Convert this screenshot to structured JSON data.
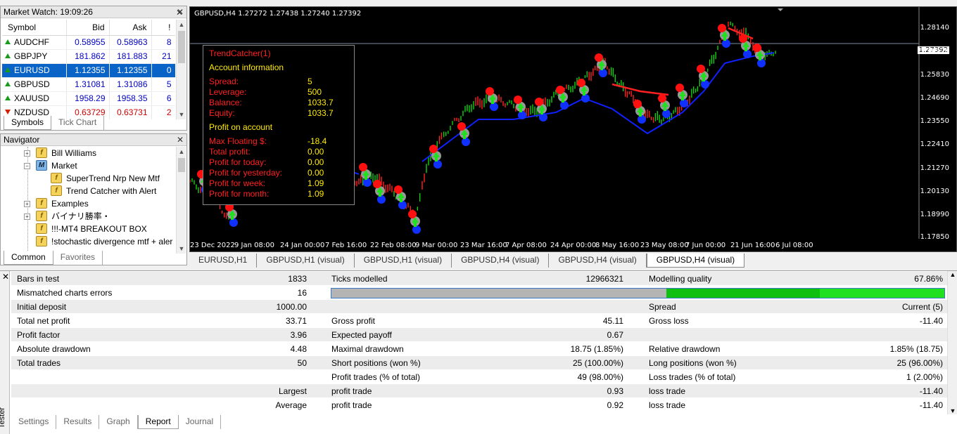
{
  "market_watch": {
    "title": "Market Watch: 19:09:26",
    "columns": {
      "symbol": "Symbol",
      "bid": "Bid",
      "ask": "Ask",
      "spread": "!"
    },
    "rows": [
      {
        "symbol": "AUDCHF",
        "bid": "0.58955",
        "ask": "0.58963",
        "spread": "8",
        "dir": "up"
      },
      {
        "symbol": "GBPJPY",
        "bid": "181.862",
        "ask": "181.883",
        "spread": "21",
        "dir": "up"
      },
      {
        "symbol": "EURUSD",
        "bid": "1.12355",
        "ask": "1.12355",
        "spread": "0",
        "dir": "up"
      },
      {
        "symbol": "GBPUSD",
        "bid": "1.31081",
        "ask": "1.31086",
        "spread": "5",
        "dir": "up"
      },
      {
        "symbol": "XAUUSD",
        "bid": "1958.29",
        "ask": "1958.35",
        "spread": "6",
        "dir": "up"
      },
      {
        "symbol": "NZDUSD",
        "bid": "0.63729",
        "ask": "0.63731",
        "spread": "2",
        "dir": "down"
      }
    ],
    "tabs": [
      "Symbols",
      "Tick Chart"
    ]
  },
  "navigator": {
    "title": "Navigator",
    "items": [
      {
        "label": "Bill Williams"
      },
      {
        "label": "Market"
      },
      {
        "label": "SuperTrend Nrp New Mtf"
      },
      {
        "label": "Trend Catcher with Alert"
      },
      {
        "label": "Examples"
      },
      {
        "label": "バイナリ勝率・"
      },
      {
        "label": "!!!-MT4 BREAKOUT BOX"
      },
      {
        "label": "!stochastic divergence mtf + aler"
      }
    ],
    "tabs": [
      "Common",
      "Favorites"
    ]
  },
  "chart": {
    "title": "GBPUSD,H4  1.27272 1.27438 1.27240 1.27392",
    "price_labels": [
      "1.28140",
      "1.27392",
      "1.26970",
      "1.25830",
      "1.24690",
      "1.23550",
      "1.22410",
      "1.21270",
      "1.20130",
      "1.18990",
      "1.17850"
    ],
    "current_price": "1.27392",
    "time_labels": [
      "23 Dec 2022",
      "9 Jan 08:00",
      "24 Jan 00:00",
      "7 Feb 16:00",
      "22 Feb 08:00",
      "9 Mar 00:00",
      "23 Mar 16:00",
      "7 Apr 08:00",
      "24 Apr 00:00",
      "8 May 16:00",
      "23 May 08:00",
      "7 Jun 00:00",
      "21 Jun 16:00",
      "6 Jul 08:00"
    ],
    "info": {
      "name": "TrendCatcher(1)",
      "account_header": "Account information",
      "spread_label": "Spread:",
      "spread": "5",
      "leverage_label": "Leverage:",
      "leverage": "500",
      "balance_label": "Balance:",
      "balance": "1033.7",
      "equity_label": "Equity:",
      "equity": "1033.7",
      "profit_header": "Profit on account",
      "max_floating_label": "Max Floating $:",
      "max_floating": "-18.4",
      "total_profit_label": "Total profit:",
      "total_profit": "0.00",
      "today_label": "Profit for today:",
      "today": "0.00",
      "yesterday_label": "Profit for yesterday:",
      "yesterday": "0.00",
      "week_label": "Profit for week:",
      "week": "1.09",
      "month_label": "Profit for month:",
      "month": "1.09"
    },
    "tabs": [
      "EURUSD,H1",
      "GBPUSD,H1 (visual)",
      "GBPUSD,H1 (visual)",
      "GBPUSD,H4 (visual)",
      "GBPUSD,H4 (visual)",
      "GBPUSD,H4 (visual)"
    ]
  },
  "report": {
    "side_label": "Tester",
    "bars_in_test_label": "Bars in test",
    "bars_in_test": "1833",
    "ticks_modelled_label": "Ticks modelled",
    "ticks_modelled": "12966321",
    "modelling_quality_label": "Modelling quality",
    "modelling_quality": "67.86%",
    "mismatched_label": "Mismatched charts errors",
    "mismatched": "16",
    "initial_deposit_label": "Initial deposit",
    "initial_deposit": "1000.00",
    "spread_label": "Spread",
    "spread": "Current (5)",
    "total_net_profit_label": "Total net profit",
    "total_net_profit": "33.71",
    "gross_profit_label": "Gross profit",
    "gross_profit": "45.11",
    "gross_loss_label": "Gross loss",
    "gross_loss": "-11.40",
    "profit_factor_label": "Profit factor",
    "profit_factor": "3.96",
    "expected_payoff_label": "Expected payoff",
    "expected_payoff": "0.67",
    "absolute_drawdown_label": "Absolute drawdown",
    "absolute_drawdown": "4.48",
    "maximal_drawdown_label": "Maximal drawdown",
    "maximal_drawdown": "18.75 (1.85%)",
    "relative_drawdown_label": "Relative drawdown",
    "relative_drawdown": "1.85% (18.75)",
    "total_trades_label": "Total trades",
    "total_trades": "50",
    "short_positions_label": "Short positions (won %)",
    "short_positions": "25 (100.00%)",
    "long_positions_label": "Long positions (won %)",
    "long_positions": "25 (96.00%)",
    "profit_trades_label": "Profit trades (% of total)",
    "profit_trades": "49 (98.00%)",
    "loss_trades_label": "Loss trades (% of total)",
    "loss_trades": "1 (2.00%)",
    "largest_label": "Largest",
    "largest_profit_label": "profit trade",
    "largest_profit": "0.93",
    "largest_loss_label": "loss trade",
    "largest_loss": "-11.40",
    "average_label": "Average",
    "average_profit_label": "profit trade",
    "average_profit": "0.92",
    "average_loss_label": "loss trade",
    "average_loss": "-11.40",
    "tabs": [
      "Settings",
      "Results",
      "Graph",
      "Report",
      "Journal"
    ]
  },
  "colors": {
    "accent": "#0a64c8",
    "bull": "#10c010",
    "bear": "#ff2020",
    "chart_bg": "#000000",
    "quality_bar": "#10c010"
  }
}
